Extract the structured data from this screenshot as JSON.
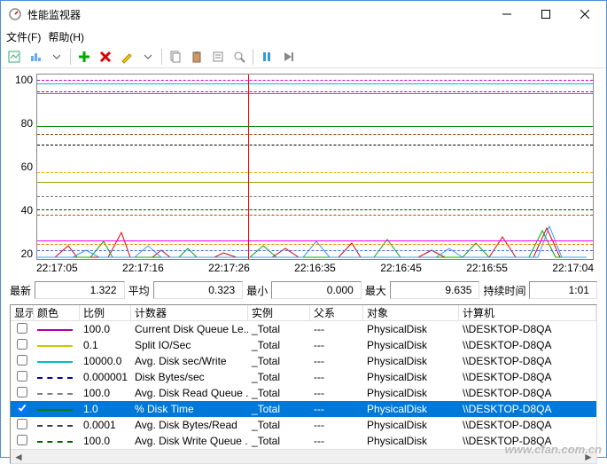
{
  "window": {
    "title": "性能监视器"
  },
  "menu": {
    "file": "文件(F)",
    "help": "帮助(H)"
  },
  "chart_data": {
    "type": "line",
    "ylim": [
      0,
      100
    ],
    "yticks": [
      100,
      80,
      60,
      40,
      20
    ],
    "xticks": [
      "22:17:05",
      "22:17:16",
      "22:17:26",
      "22:16:35",
      "22:16:45",
      "22:16:55",
      "22:17:04"
    ],
    "cursor_x_fraction": 0.38,
    "series": [
      {
        "color": "#00bcd4",
        "style": "solid",
        "static_y": 95
      },
      {
        "color": "#d000d0",
        "style": "dash",
        "static_y": 97
      },
      {
        "color": "#b000b0",
        "style": "dash",
        "static_y": 91
      },
      {
        "color": "#00aaff",
        "style": "solid",
        "static_y": 90
      },
      {
        "color": "#008000",
        "style": "solid",
        "static_y": 72
      },
      {
        "color": "#8B4513",
        "style": "dash",
        "static_y": 68
      },
      {
        "color": "#000000",
        "style": "dash",
        "static_y": 62
      },
      {
        "color": "#ffb000",
        "style": "dash",
        "static_y": 47
      },
      {
        "color": "#a0a000",
        "style": "solid",
        "static_y": 42
      },
      {
        "color": "#888888",
        "style": "dash",
        "static_y": 34
      },
      {
        "color": "#004000",
        "style": "dash",
        "static_y": 27
      },
      {
        "color": "#c04000",
        "style": "dash",
        "static_y": 24
      },
      {
        "color": "#ff00ff",
        "style": "solid",
        "static_y": 10
      },
      {
        "color": "#ff8000",
        "style": "dash",
        "static_y": 8
      },
      {
        "color": "#4169e1",
        "style": "dash",
        "static_y": 5
      }
    ]
  },
  "stats": {
    "labels": {
      "latest": "最新",
      "avg": "平均",
      "min": "最小",
      "max": "最大",
      "duration": "持续时间"
    },
    "values": {
      "latest": "1.322",
      "avg": "0.323",
      "min": "0.000",
      "max": "9.635",
      "duration": "1:01"
    }
  },
  "columns": {
    "show": "显示",
    "color": "颜色",
    "scale": "比例",
    "counter": "计数器",
    "instance": "实例",
    "parent": "父系",
    "object": "对象",
    "computer": "计算机"
  },
  "rows": [
    {
      "checked": false,
      "color": "#b000b0",
      "dash": false,
      "scale": "100.0",
      "counter": "Current Disk Queue Le...",
      "instance": "_Total",
      "parent": "---",
      "object": "PhysicalDisk",
      "computer": "\\\\DESKTOP-D8QA",
      "selected": false
    },
    {
      "checked": false,
      "color": "#c8c800",
      "dash": false,
      "scale": "0.1",
      "counter": "Split IO/Sec",
      "instance": "_Total",
      "parent": "---",
      "object": "PhysicalDisk",
      "computer": "\\\\DESKTOP-D8QA",
      "selected": false
    },
    {
      "checked": false,
      "color": "#00bcd4",
      "dash": false,
      "scale": "10000.0",
      "counter": "Avg. Disk sec/Write",
      "instance": "_Total",
      "parent": "---",
      "object": "PhysicalDisk",
      "computer": "\\\\DESKTOP-D8QA",
      "selected": false
    },
    {
      "checked": false,
      "color": "#0000aa",
      "dash": true,
      "scale": "0.000001",
      "counter": "Disk Bytes/sec",
      "instance": "_Total",
      "parent": "---",
      "object": "PhysicalDisk",
      "computer": "\\\\DESKTOP-D8QA",
      "selected": false
    },
    {
      "checked": false,
      "color": "#808080",
      "dash": true,
      "scale": "100.0",
      "counter": "Avg. Disk Read Queue ...",
      "instance": "_Total",
      "parent": "---",
      "object": "PhysicalDisk",
      "computer": "\\\\DESKTOP-D8QA",
      "selected": false
    },
    {
      "checked": true,
      "color": "#008000",
      "dash": false,
      "scale": "1.0",
      "counter": "% Disk Time",
      "instance": "_Total",
      "parent": "---",
      "object": "PhysicalDisk",
      "computer": "\\\\DESKTOP-D8QA",
      "selected": true
    },
    {
      "checked": false,
      "color": "#404040",
      "dash": true,
      "scale": "0.0001",
      "counter": "Avg. Disk Bytes/Read",
      "instance": "_Total",
      "parent": "---",
      "object": "PhysicalDisk",
      "computer": "\\\\DESKTOP-D8QA",
      "selected": false
    },
    {
      "checked": false,
      "color": "#006000",
      "dash": true,
      "scale": "100.0",
      "counter": "Avg. Disk Write Queue ...",
      "instance": "_Total",
      "parent": "---",
      "object": "PhysicalDisk",
      "computer": "\\\\DESKTOP-D8QA",
      "selected": false
    }
  ],
  "watermark": "www.cfan.com.cn"
}
